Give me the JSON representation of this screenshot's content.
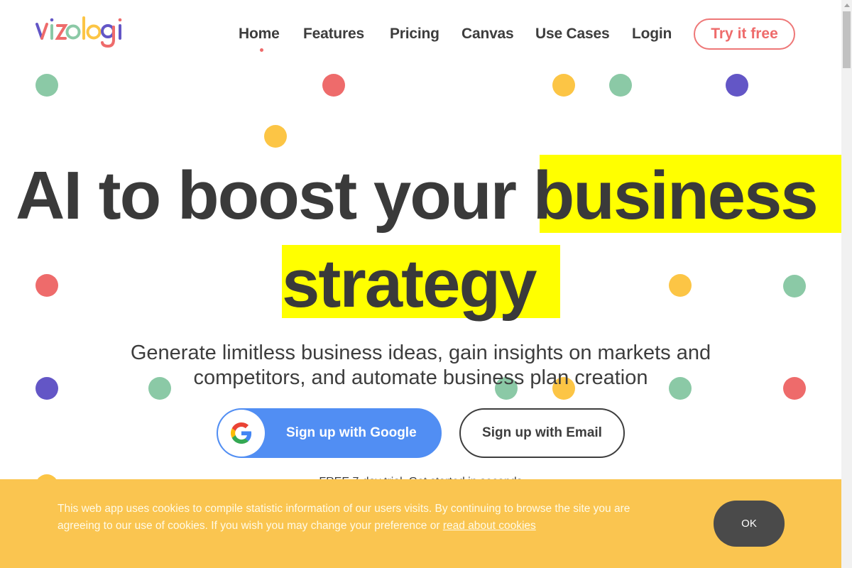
{
  "brand": {
    "name": "vizologi"
  },
  "nav": {
    "items": [
      {
        "label": "Home",
        "active": true
      },
      {
        "label": "Features"
      },
      {
        "label": "Pricing"
      },
      {
        "label": "Canvas"
      },
      {
        "label": "Use Cases"
      },
      {
        "label": "Login"
      }
    ],
    "cta_label": "Try it free"
  },
  "hero": {
    "line1_plain": "AI to boost your",
    "line1_highlight": "business",
    "line2_highlight": "strategy",
    "subtitle_line1": "Generate limitless business ideas, gain insights on markets and",
    "subtitle_line2": "competitors, and automate business plan creation",
    "google_button_label": "Sign up with Google",
    "email_button_label": "Sign up with Email",
    "trial_note": "FREE 7-day trial. Get started in seconds"
  },
  "cookie_banner": {
    "text": "This web app uses cookies to compile statistic information of our users visits. By continuing to browse the site you are agreeing to our use of cookies. If you wish you may change your preference or ",
    "link_label": "read about cookies",
    "ok_label": "OK"
  },
  "colors": {
    "accent_red": "#ee6b6b",
    "green": "#8bc9a6",
    "yellow": "#fcc545",
    "purple": "#6356c6",
    "highlight": "#ffff00",
    "google_blue": "#518ef3",
    "cookie_bg": "#fac550"
  }
}
